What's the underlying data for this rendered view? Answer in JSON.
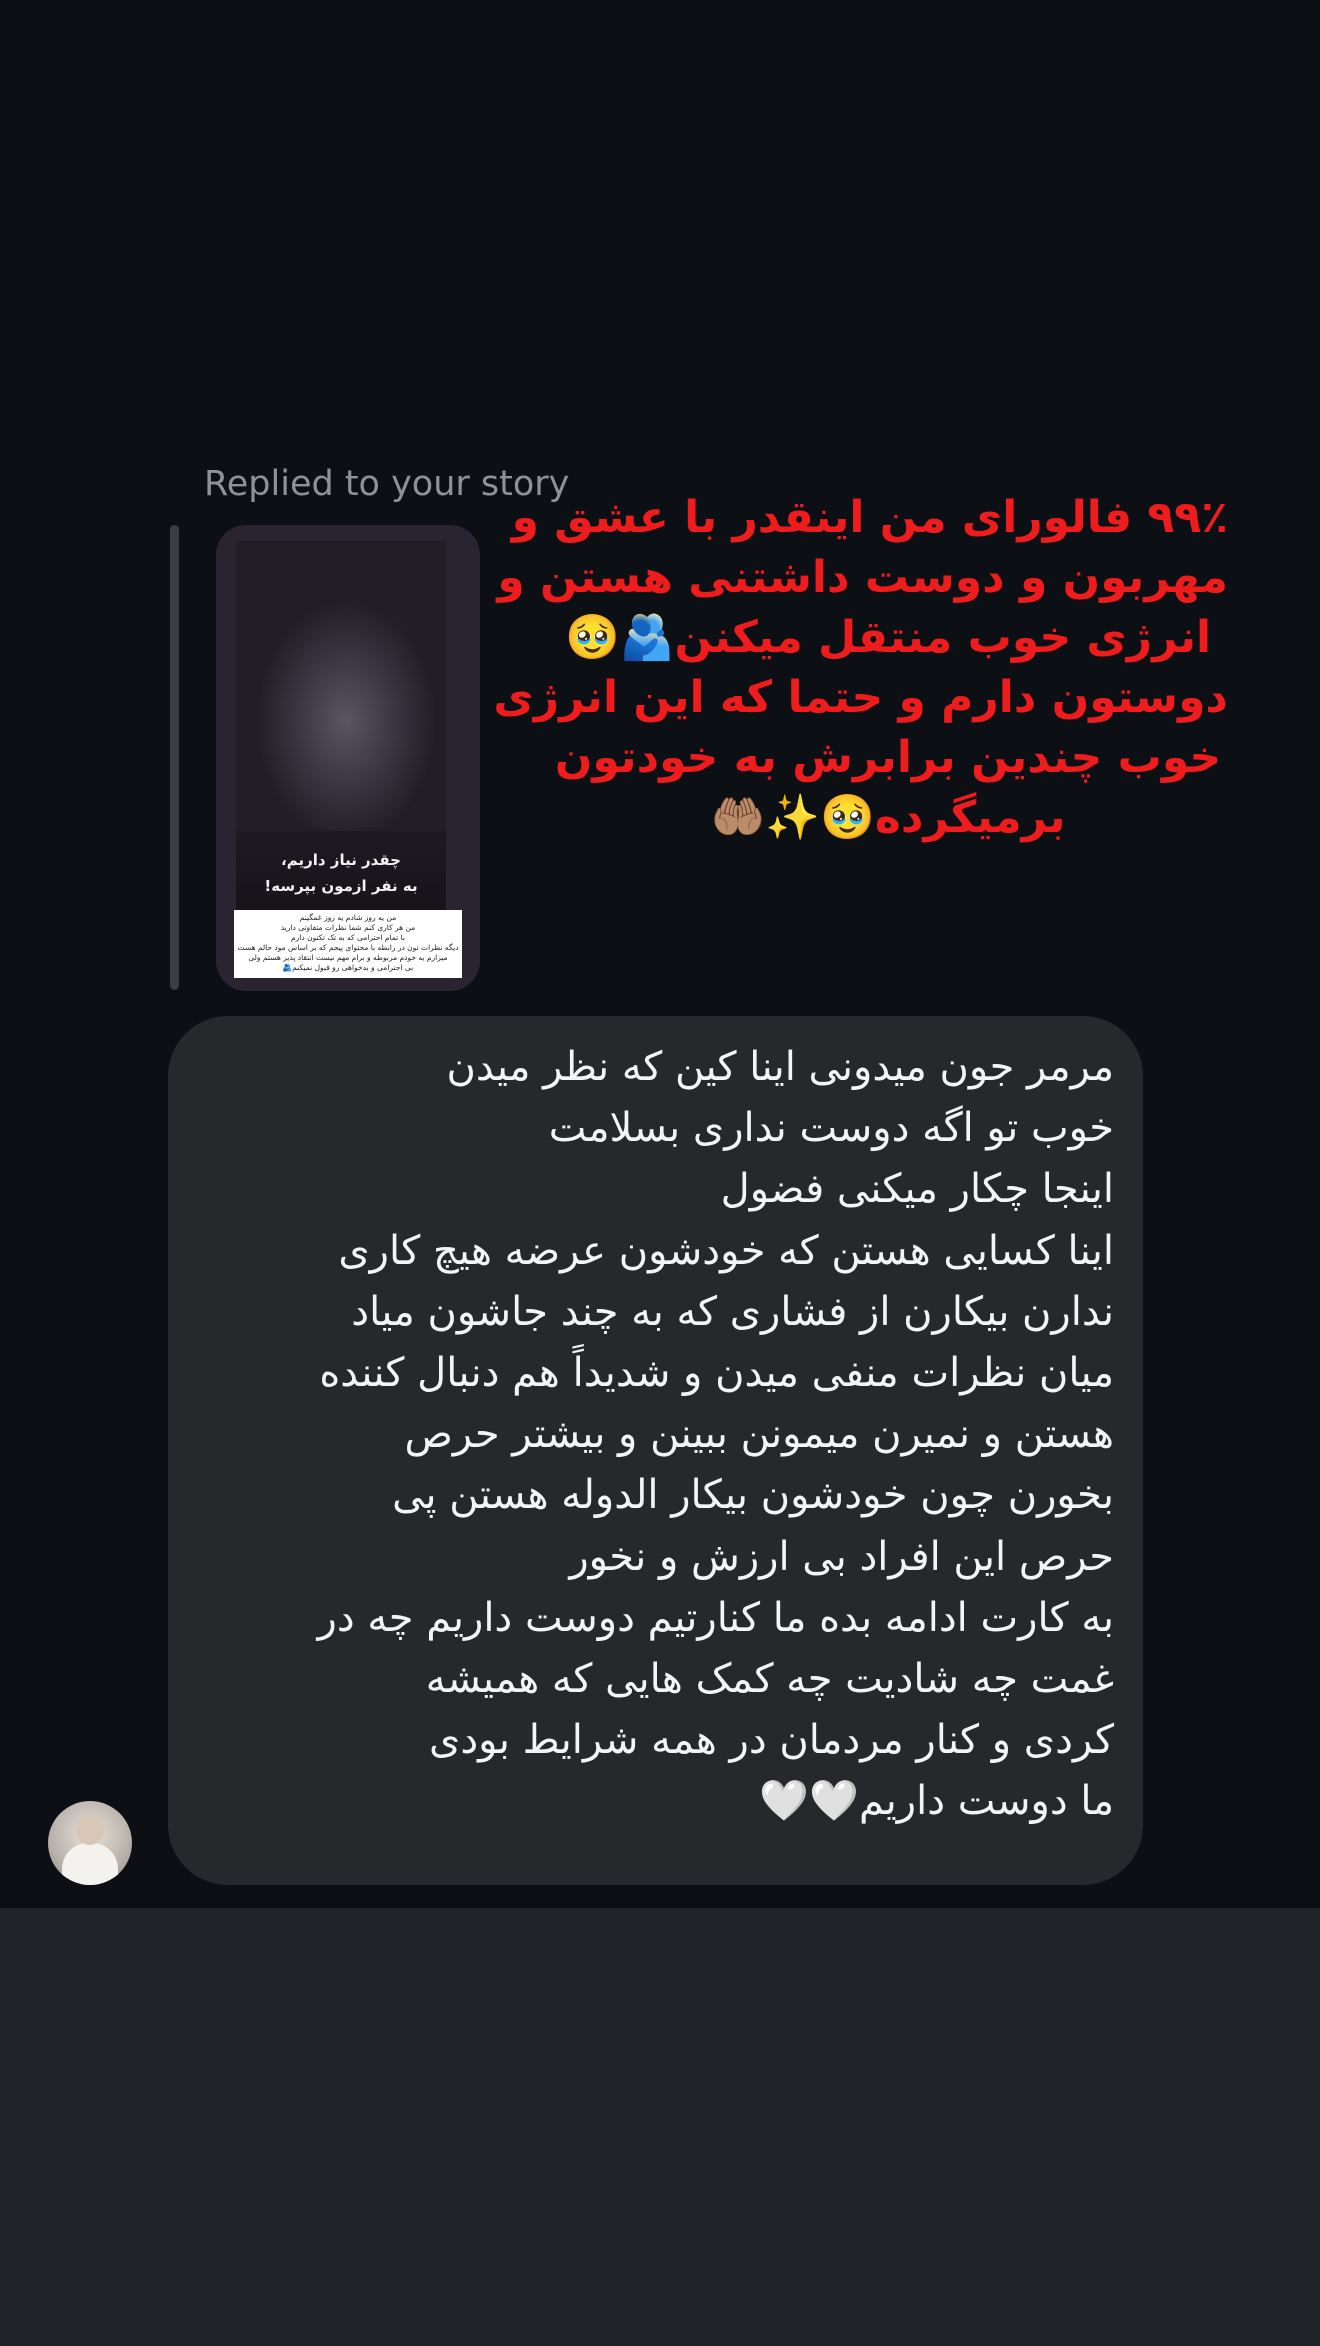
{
  "thread": {
    "replied_label": "Replied to your story",
    "story": {
      "caption_lines": [
        "چقدر نیاز داریم،",
        "به نفر ازمون بپرسه!"
      ],
      "note_lines": [
        "من یه روز شادم یه روز غمگینم",
        "من هر کاری کنم شما نظرات متفاوتی دارید",
        "با تمام احترامی که به تک تکتون دارم",
        "دیگه نظرات تون در رابطه با محتوای پیجم که بر اساس مود حالم هست",
        "میزارم یه خودم مربوطه و برام مهم نیست انتقاد پذیر هستم ولی",
        "بی احترامی و بدخواهی رو قبول نمیکنم🫂"
      ]
    },
    "story_reply_lines": [
      "۹۹٪ فالورای من اینقدر با عشق و",
      "مهربون و دوست داشتنی هستن و",
      "انرژی خوب منتقل میکنن🫂🥹",
      "دوستون دارم و حتما که این انرژی",
      "خوب چندین برابرش به خودتون",
      "برمیگرده🥹✨🤲🏽"
    ],
    "message_lines": [
      "مرمر جون میدونی اینا کین که نظر میدن",
      "خوب تو اگه دوست نداری بسلامت",
      "اینجا چکار میکنی فضول",
      "اینا کسایی هستن که خودشون عرضه هیچ کاری",
      "ندارن بیکارن از فشاری که به چند جاشون میاد",
      "میان نظرات منفی میدن و شدیداً هم دنبال کننده",
      "هستن و نمیرن میمونن ببینن و بیشتر حرص",
      "بخورن چون خودشون بیکار الدوله هستن پی",
      "حرص این افراد بی ارزش و نخور",
      "به کارت ادامه بده ما کنارتیم دوست داریم چه در",
      "غمت چه شادیت چه کمک هایی که همیشه",
      "کردی و کنار مردمان در همه شرایط بودی",
      "ما دوست داریم🤍🤍"
    ]
  },
  "colors": {
    "page_bg": "#0b0e13",
    "bubble_bg": "#26282c",
    "story_reply_text": "#ee1c1c",
    "message_text": "#f3f4f6",
    "muted_text": "#8e9196",
    "bottom_bar": "#202327"
  }
}
